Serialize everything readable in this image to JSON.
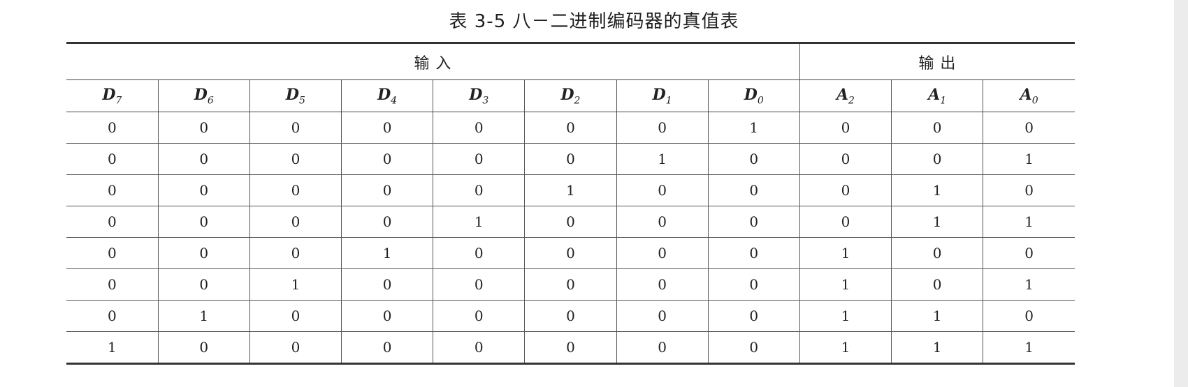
{
  "title": "表 3-5   八－二进制编码器的真值表",
  "group_headers": {
    "input": "输    入",
    "output": "输    出"
  },
  "columns": [
    {
      "letter": "D",
      "sub": "7"
    },
    {
      "letter": "D",
      "sub": "6"
    },
    {
      "letter": "D",
      "sub": "5"
    },
    {
      "letter": "D",
      "sub": "4"
    },
    {
      "letter": "D",
      "sub": "3"
    },
    {
      "letter": "D",
      "sub": "2"
    },
    {
      "letter": "D",
      "sub": "1"
    },
    {
      "letter": "D",
      "sub": "0"
    },
    {
      "letter": "A",
      "sub": "2"
    },
    {
      "letter": "A",
      "sub": "1"
    },
    {
      "letter": "A",
      "sub": "0"
    }
  ],
  "rows": [
    [
      "0",
      "0",
      "0",
      "0",
      "0",
      "0",
      "0",
      "1",
      "0",
      "0",
      "0"
    ],
    [
      "0",
      "0",
      "0",
      "0",
      "0",
      "0",
      "1",
      "0",
      "0",
      "0",
      "1"
    ],
    [
      "0",
      "0",
      "0",
      "0",
      "0",
      "1",
      "0",
      "0",
      "0",
      "1",
      "0"
    ],
    [
      "0",
      "0",
      "0",
      "0",
      "1",
      "0",
      "0",
      "0",
      "0",
      "1",
      "1"
    ],
    [
      "0",
      "0",
      "0",
      "1",
      "0",
      "0",
      "0",
      "0",
      "1",
      "0",
      "0"
    ],
    [
      "0",
      "0",
      "1",
      "0",
      "0",
      "0",
      "0",
      "0",
      "1",
      "0",
      "1"
    ],
    [
      "0",
      "1",
      "0",
      "0",
      "0",
      "0",
      "0",
      "0",
      "1",
      "1",
      "0"
    ],
    [
      "1",
      "0",
      "0",
      "0",
      "0",
      "0",
      "0",
      "0",
      "1",
      "1",
      "1"
    ]
  ]
}
